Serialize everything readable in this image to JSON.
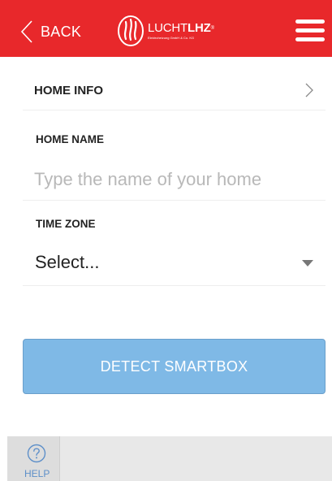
{
  "header": {
    "back_label": "BACK",
    "logo": {
      "name_light": "LUCHT",
      "name_bold": "LHZ",
      "registered_mark": "®",
      "subtitle": "Elektroheizung GmbH & Co. KG"
    }
  },
  "section": {
    "title": "HOME INFO"
  },
  "fields": {
    "home_name_label": "HOME NAME",
    "home_name_placeholder": "Type the name of your home",
    "home_name_value": "",
    "time_zone_label": "TIME ZONE",
    "time_zone_value": "Select..."
  },
  "actions": {
    "detect_label": "DETECT SMARTBOX"
  },
  "footer": {
    "help_label": "HELP"
  },
  "colors": {
    "header_bg": "#e8282b",
    "button_bg": "#7fb9e6",
    "help_accent": "#5d8fc9",
    "placeholder": "#b8b8b8"
  },
  "icons": {
    "back": "chevron-left-icon",
    "logo": "flame-logo-icon",
    "menu": "hamburger-menu-icon",
    "section": "chevron-right-icon",
    "select": "caret-down-icon",
    "help": "question-circle-icon"
  }
}
